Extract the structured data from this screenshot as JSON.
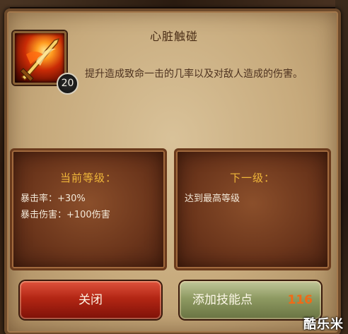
{
  "skill": {
    "title": "心脏触碰",
    "level": "20",
    "icon": "flame-sword-icon",
    "description": "提升造成致命一击的几率以及对敌人造成的伤害。"
  },
  "current_level": {
    "heading": "当前等级：",
    "lines": [
      "暴击率：+30%",
      "暴击伤害：+100伤害"
    ]
  },
  "next_level": {
    "heading": "下一级：",
    "lines": [
      "达到最高等级"
    ]
  },
  "buttons": {
    "close_label": "关闭",
    "add_label": "添加技能点",
    "add_count": "116"
  },
  "watermark": "酷乐米",
  "colors": {
    "heading_gold": "#f0b73a",
    "count_orange": "#f06a16",
    "close_red": "#b32614",
    "add_green": "#8e9a62"
  }
}
